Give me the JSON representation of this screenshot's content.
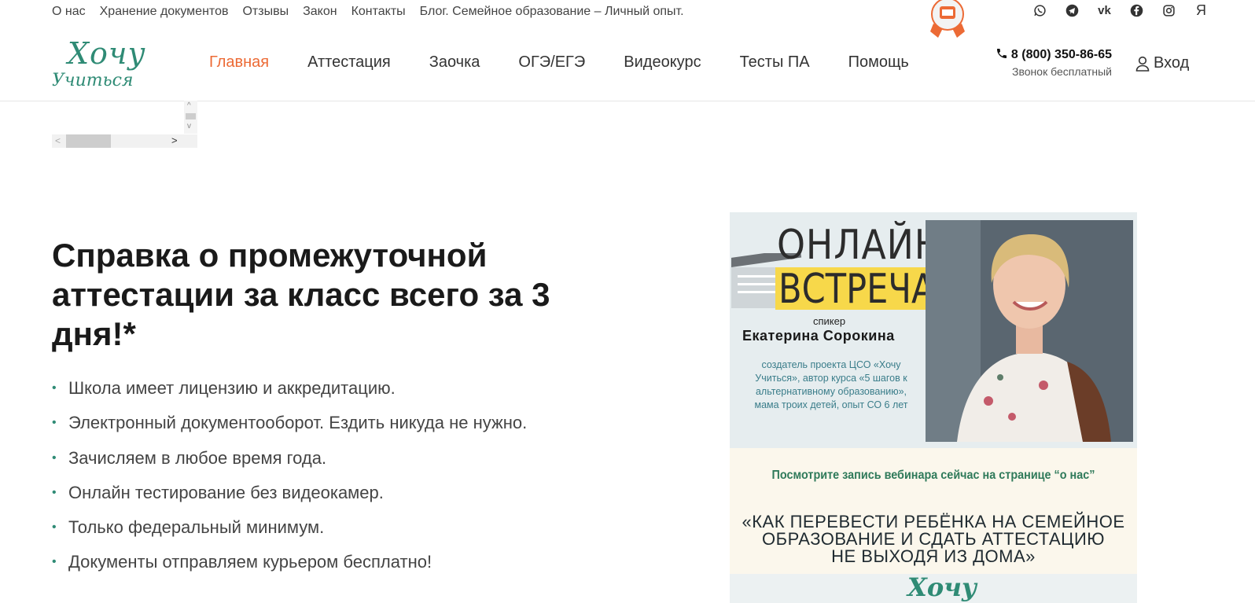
{
  "topbar": {
    "links": [
      "О нас",
      "Хранение документов",
      "Отзывы",
      "Закон",
      "Контакты",
      "Блог. Семейное образование – Личный опыт."
    ],
    "socials": [
      "whatsapp-icon",
      "telegram-icon",
      "vk-icon",
      "facebook-icon",
      "instagram-icon",
      "yandex-icon"
    ],
    "yandex_letter": "Я",
    "vk_letter": "vk"
  },
  "logo": {
    "line1": "Хочу",
    "line2": "Учиться"
  },
  "nav": {
    "items": [
      "Главная",
      "Аттестация",
      "Заочка",
      "ОГЭ/ЕГЭ",
      "Видеокурс",
      "Тесты ПА",
      "Помощь"
    ],
    "active_index": 0
  },
  "contact": {
    "phone": "8 (800) 350-86-65",
    "note": "Звонок бесплатный"
  },
  "login": {
    "label": "Вход"
  },
  "hero": {
    "title": "Справка о промежуточной аттестации за класс всего за 3 дня!*",
    "bullets": [
      "Школа имеет лицензию и аккредитацию.",
      "Электронный документооборот. Ездить никуда не нужно.",
      "Зачисляем в любое время года.",
      "Онлайн тестирование без видеокамер.",
      "Только федеральный минимум.",
      "Документы отправляем курьером бесплатно!"
    ]
  },
  "promo": {
    "line1": "ОНЛАЙН",
    "line2": "ВСТРЕЧА",
    "speaker_label": "спикер",
    "speaker_name": "Екатерина Сорокина",
    "speaker_desc": "создатель проекта ЦСО «Хочу Учиться», автор курса «5 шагов к альтернативному образованию», мама троих детей, опыт СО 6 лет",
    "cta": "Посмотрите запись вебинара сейчас на странице “о нас”",
    "headline1": "«КАК ПЕРЕВЕСТИ РЕБЁНКА НА СЕМЕЙНОЕ",
    "headline2": "ОБРАЗОВАНИЕ И СДАТЬ АТТЕСТАЦИЮ",
    "headline3": "НЕ ВЫХОДЯ ИЗ ДОМА»",
    "logo_text": "Хочу"
  },
  "colors": {
    "accent": "#ec6a35",
    "brand": "#2f8b75",
    "highlight": "#f7d84a"
  }
}
